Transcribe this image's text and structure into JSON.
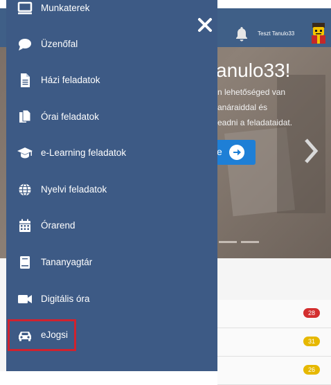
{
  "header": {
    "user_name": "Teszt Tanulo33"
  },
  "hero": {
    "title": "anulo33!",
    "lines": [
      "n lehetőséged van",
      "anáraiddal és",
      "eadni a feladataidat."
    ],
    "button_label": "e"
  },
  "badges": [
    "28",
    "31",
    "26"
  ],
  "badge_colors": [
    "#d32f2f",
    "#e6b800",
    "#e6b800"
  ],
  "drawer": {
    "items": [
      {
        "label": "Munkaterek",
        "icon": "desktop-icon"
      },
      {
        "label": "Üzenőfal",
        "icon": "chat-bubble-icon"
      },
      {
        "label": "Házi feladatok",
        "icon": "document-icon"
      },
      {
        "label": "Órai feladatok",
        "icon": "copy-documents-icon"
      },
      {
        "label": "e-Learning feladatok",
        "icon": "graduation-cap-icon"
      },
      {
        "label": "Nyelvi feladatok",
        "icon": "globe-icon"
      },
      {
        "label": "Órarend",
        "icon": "calendar-icon"
      },
      {
        "label": "Tananyagtár",
        "icon": "book-icon"
      },
      {
        "label": "Digitális óra",
        "icon": "video-camera-icon"
      },
      {
        "label": "eJogsi",
        "icon": "car-icon"
      }
    ],
    "highlighted_item": "eJogsi",
    "highlight_color": "#d0222e"
  },
  "colors": {
    "drawer_bg": "#3d5a85",
    "topbar_bg": "#3f5f87",
    "hero_button": "#1e7fd6"
  }
}
